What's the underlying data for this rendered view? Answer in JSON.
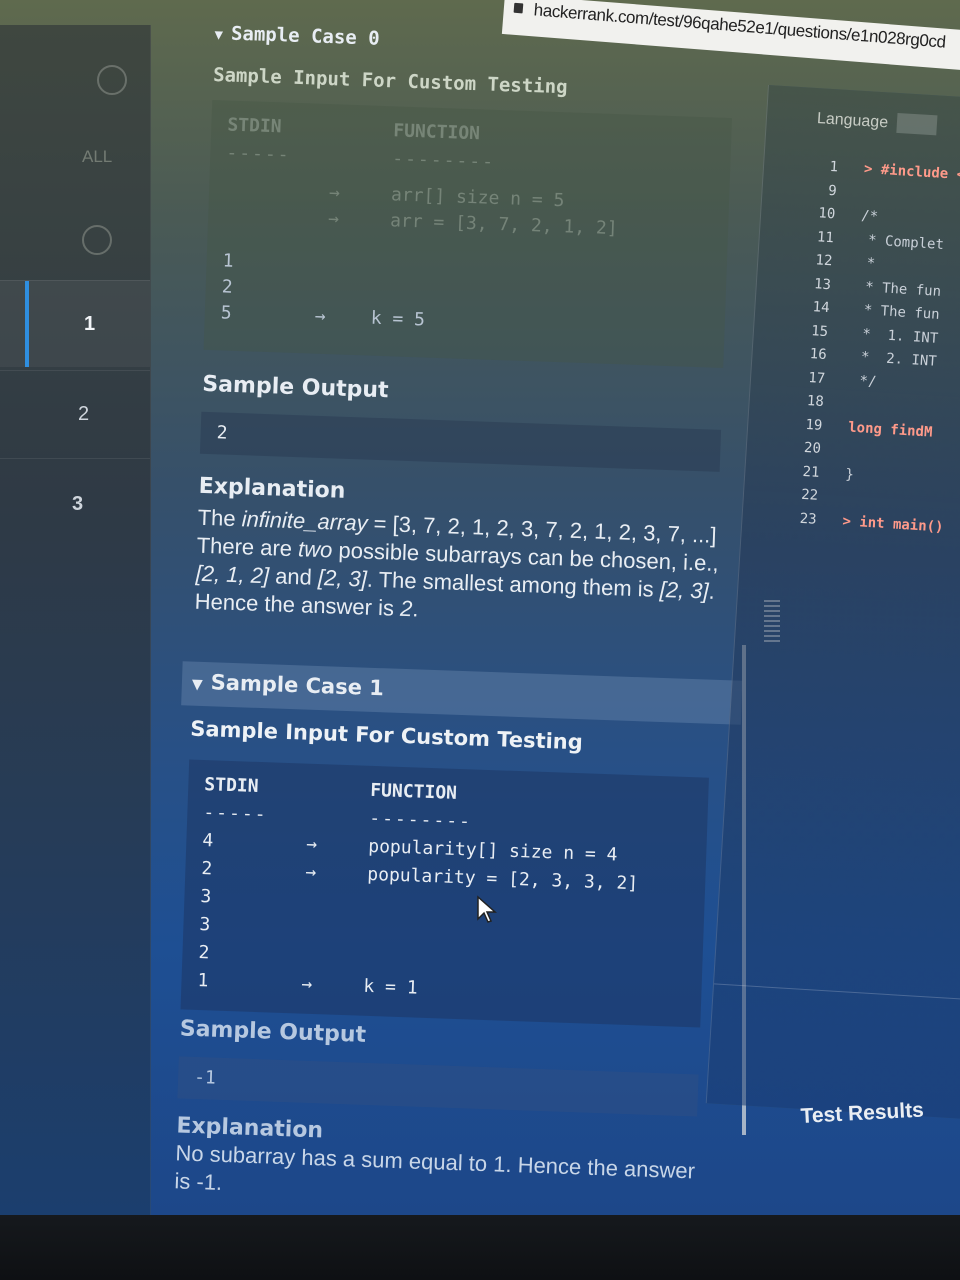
{
  "browser": {
    "url": "hackerrank.com/test/96qahe52e1/questions/e1n028rg0cd"
  },
  "sidebar": {
    "items": [
      {
        "label": "ALL"
      },
      {
        "label": "1"
      },
      {
        "label": "2"
      },
      {
        "label": "3"
      }
    ]
  },
  "case0": {
    "title": "Sample Case 0",
    "input_heading": "Sample Input For Custom Testing",
    "stdin_header": "STDIN",
    "function_header": "FUNCTION",
    "dashes_stdin": "-----",
    "dashes_function": "--------",
    "rows": [
      {
        "stdin": "",
        "arrow": "→",
        "fn": "arr[] size n = 5"
      },
      {
        "stdin": "",
        "arrow": "→",
        "fn": "arr = [3, 7, 2, 1, 2]"
      },
      {
        "stdin": "1",
        "arrow": "",
        "fn": ""
      },
      {
        "stdin": "2",
        "arrow": "",
        "fn": ""
      },
      {
        "stdin": "5",
        "arrow": "→",
        "fn": "k = 5"
      }
    ],
    "output_label": "Sample Output",
    "output_value": "2",
    "explanation_label": "Explanation",
    "explanation_parts": {
      "p1": "The ",
      "p2": "infinite_array",
      "p3": " = [3, 7, 2, 1, 2, 3, 7, 2, 1, 2, 3, 7, ...] There are ",
      "p4": "two",
      "p5": " possible subarrays can be chosen, i.e., ",
      "p6": "[2, 1, 2]",
      "p7": " and ",
      "p8": "[2, 3]",
      "p9": ". The smallest among them is ",
      "p10": "[2, 3]",
      "p11": ". Hence the answer is ",
      "p12": "2",
      "p13": "."
    }
  },
  "case1": {
    "title": "Sample Case 1",
    "input_heading": "Sample Input For Custom Testing",
    "stdin_header": "STDIN",
    "function_header": "FUNCTION",
    "dashes_stdin": "-----",
    "dashes_function": "--------",
    "rows": [
      {
        "stdin": "4",
        "arrow": "→",
        "fn": "popularity[] size n = 4"
      },
      {
        "stdin": "2",
        "arrow": "→",
        "fn": "popularity = [2, 3, 3, 2]"
      },
      {
        "stdin": "3",
        "arrow": "",
        "fn": ""
      },
      {
        "stdin": "3",
        "arrow": "",
        "fn": ""
      },
      {
        "stdin": "2",
        "arrow": "",
        "fn": ""
      },
      {
        "stdin": "1",
        "arrow": "→",
        "fn": "k = 1"
      }
    ],
    "output_label": "Sample Output",
    "output_value": "-1",
    "explanation_label": "Explanation",
    "explanation_text": "No subarray has a sum equal to 1. Hence the answer is -1."
  },
  "editor": {
    "language_label": "Language",
    "lines": [
      {
        "num": "1",
        "text": "> #include <",
        "kind": "kw"
      },
      {
        "num": "9",
        "text": "",
        "kind": "cm"
      },
      {
        "num": "10",
        "text": "/*",
        "kind": "cm"
      },
      {
        "num": "11",
        "text": " * Complet",
        "kind": "cm"
      },
      {
        "num": "12",
        "text": " *",
        "kind": "cm"
      },
      {
        "num": "13",
        "text": " * The fun",
        "kind": "cm"
      },
      {
        "num": "14",
        "text": " * The fun",
        "kind": "cm"
      },
      {
        "num": "15",
        "text": " *  1. INT",
        "kind": "cm"
      },
      {
        "num": "16",
        "text": " *  2. INT",
        "kind": "cm"
      },
      {
        "num": "17",
        "text": " */",
        "kind": "cm"
      },
      {
        "num": "18",
        "text": "",
        "kind": "cm"
      },
      {
        "num": "19",
        "text": "long findM",
        "kind": "kw"
      },
      {
        "num": "20",
        "text": "",
        "kind": "cm"
      },
      {
        "num": "21",
        "text": "}",
        "kind": "cm"
      },
      {
        "num": "22",
        "text": "",
        "kind": "cm"
      },
      {
        "num": "23",
        "text": "> int main()",
        "kind": "kw"
      }
    ],
    "test_results_label": "Test Results"
  }
}
